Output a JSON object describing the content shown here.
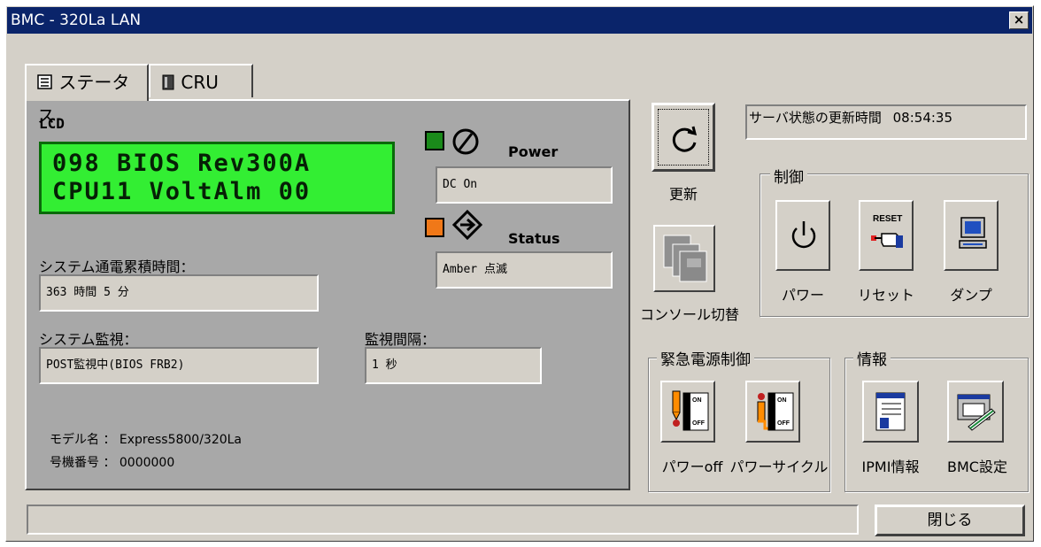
{
  "window": {
    "title": "BMC - 320La LAN",
    "close_glyph": "×"
  },
  "tabs": [
    {
      "label": "ステータス",
      "icon": "status-panel-icon"
    },
    {
      "label": "CRU",
      "icon": "cru-module-icon"
    }
  ],
  "lcd": {
    "label": "LCD",
    "line1": "098 BIOS Rev300A",
    "line2": "CPU11 VoltAlm 00"
  },
  "power": {
    "label": "Power",
    "value": "DC On",
    "led_color": "#1a8a1a"
  },
  "status": {
    "label": "Status",
    "value": "Amber 点滅",
    "led_color": "#f07818"
  },
  "uptime": {
    "label": "システム通電累積時間：",
    "value": "363 時間 5 分"
  },
  "monitor": {
    "label": "システム監視：",
    "value": "POST監視中(BIOS FRB2)"
  },
  "interval": {
    "label": "監視間隔：",
    "value": "1 秒"
  },
  "model": {
    "label": "モデル名 ： Express5800/320La"
  },
  "serial": {
    "label": "号機番号 ： 0000000"
  },
  "refresh": {
    "label": "更新"
  },
  "console": {
    "label": "コンソール切替"
  },
  "update_time": {
    "label": "サーバ状態の更新時間",
    "value": "08:54:35"
  },
  "control": {
    "title": "制御",
    "power_label": "パワー",
    "reset_label": "リセット",
    "reset_text": "RESET",
    "dump_label": "ダンプ"
  },
  "emergency": {
    "title": "緊急電源制御",
    "power_off_label": "パワーoff",
    "power_cycle_label": "パワーサイクル",
    "on_text": "ON",
    "off_text": "OFF"
  },
  "info": {
    "title": "情報",
    "ipmi_label": "IPMI情報",
    "bmc_label": "BMC設定"
  },
  "close_button": {
    "label": "閉じる"
  },
  "status_bar": {
    "text": ""
  }
}
